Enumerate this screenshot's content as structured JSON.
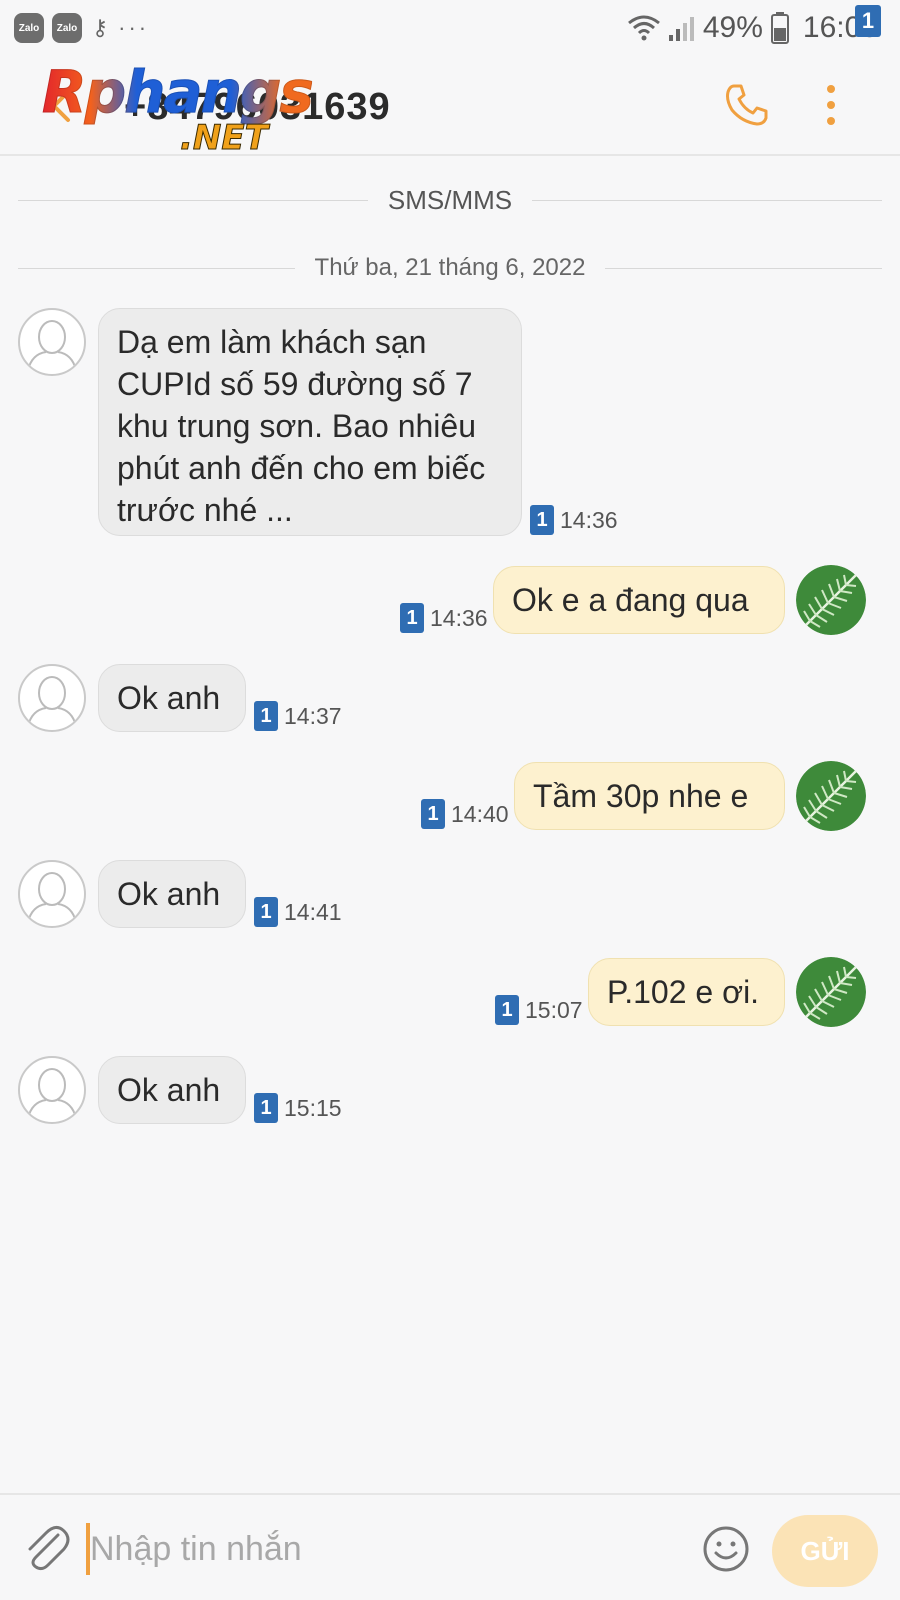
{
  "status_bar": {
    "zalo1": "Zalo",
    "zalo2": "Zalo",
    "dots": "···",
    "battery": "49%",
    "time": "16:00"
  },
  "header": {
    "contact": "+84796031639",
    "watermark_top": "Rphangs",
    "watermark_bottom": ".NET",
    "accent_color": "#f0a040"
  },
  "dividers": {
    "channel": "SMS/MMS",
    "date": "Thứ ba, 21 tháng 6, 2022"
  },
  "messages": [
    {
      "dir": "in",
      "text": "Dạ em làm khách sạn CUPId  số 59 đường số 7 khu trung sơn. Bao nhiêu phút anh đến cho em biếc trước nhé ...",
      "sim": "1",
      "time": "14:36"
    },
    {
      "dir": "out",
      "text": "Ok e a đang qua",
      "sim": "1",
      "time": "14:36"
    },
    {
      "dir": "in",
      "text": "Ok anh",
      "sim": "1",
      "time": "14:37"
    },
    {
      "dir": "out",
      "text": "Tầm 30p nhe e",
      "sim": "1",
      "time": "14:40"
    },
    {
      "dir": "in",
      "text": "Ok anh",
      "sim": "1",
      "time": "14:41"
    },
    {
      "dir": "out",
      "text": "P.102 e ơi.",
      "sim": "1",
      "time": "15:07"
    },
    {
      "dir": "in",
      "text": "Ok anh",
      "sim": "1",
      "time": "15:15"
    }
  ],
  "compose": {
    "placeholder": "Nhập tin nhắn",
    "send_label": "GỬI",
    "sim_badge": "1"
  }
}
